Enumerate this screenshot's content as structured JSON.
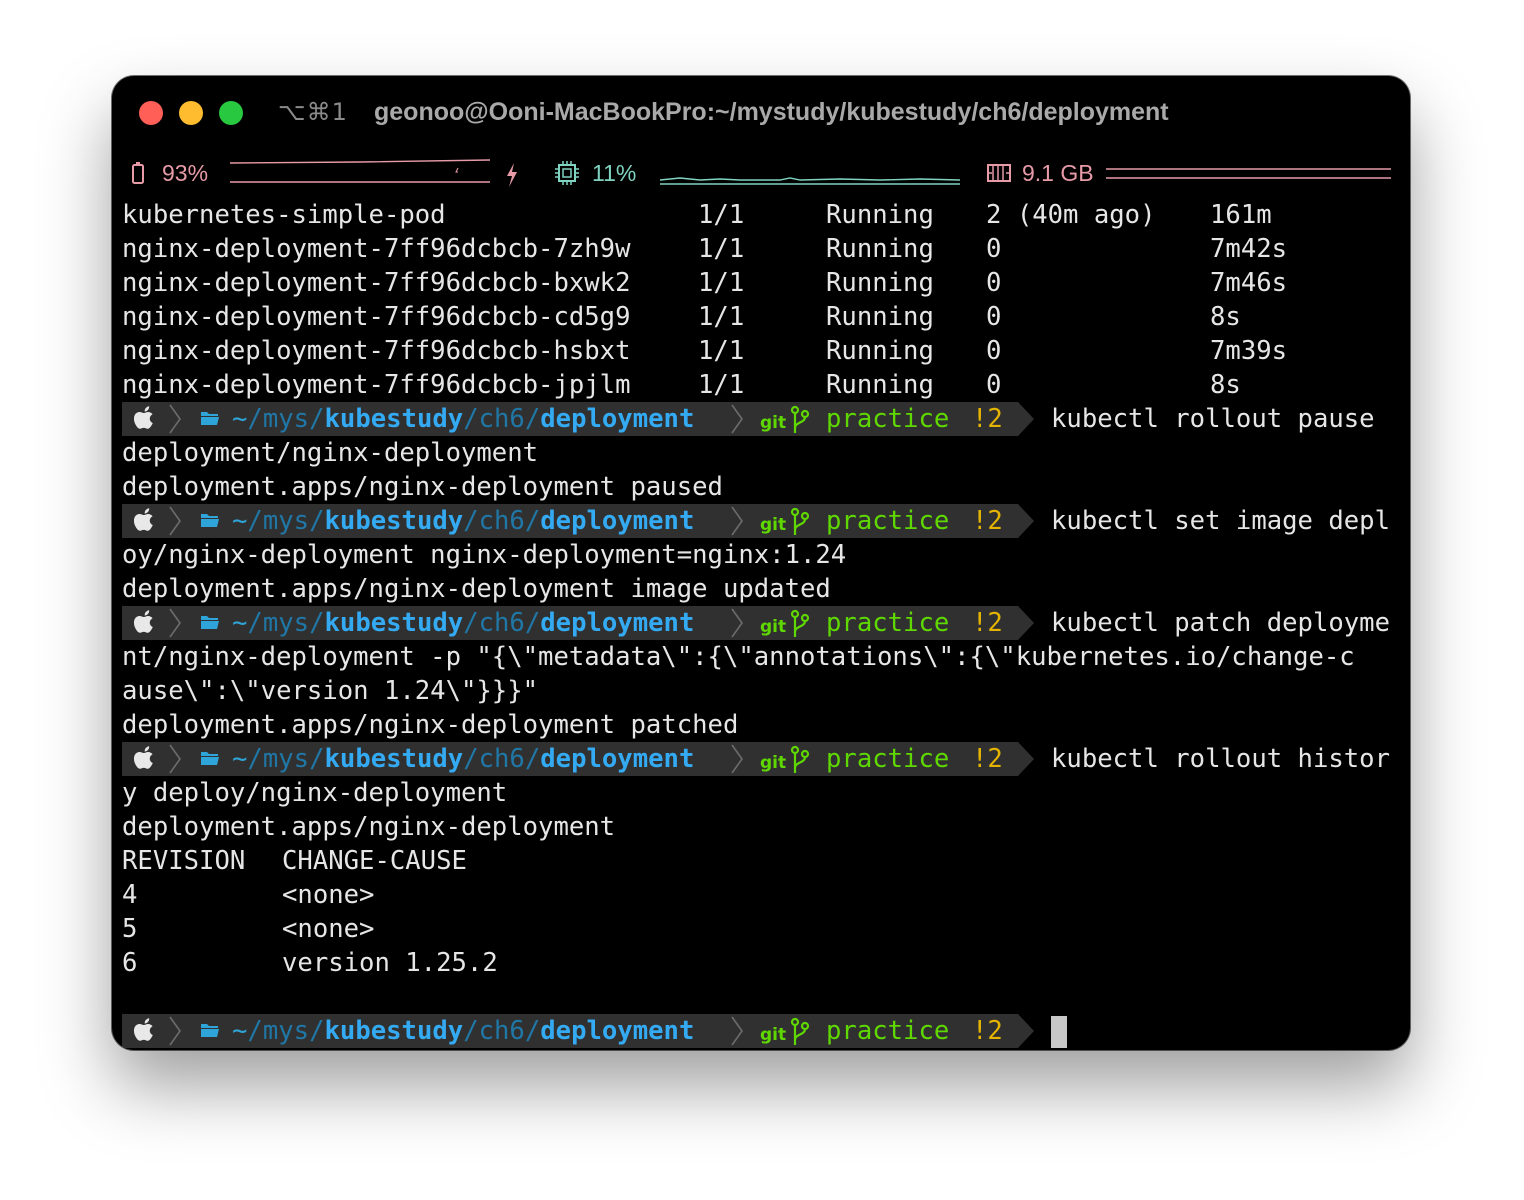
{
  "window": {
    "shortcut": "⌥⌘1",
    "title": "geonoo@Ooni-MacBookPro:~/mystudy/kubestudy/ch6/deployment"
  },
  "statusbar": {
    "battery_percent": "93%",
    "cpu_percent": "11%",
    "memory": "9.1 GB",
    "colors": {
      "battery": "#e79ba7",
      "cpu": "#7fd3c0",
      "memory": "#e79ba7"
    }
  },
  "pods": [
    {
      "name": "kubernetes-simple-pod",
      "ready": "1/1",
      "status": "Running",
      "restarts": "2 (40m ago)",
      "age": "161m"
    },
    {
      "name": "nginx-deployment-7ff96dcbcb-7zh9w",
      "ready": "1/1",
      "status": "Running",
      "restarts": "0",
      "age": "7m42s"
    },
    {
      "name": "nginx-deployment-7ff96dcbcb-bxwk2",
      "ready": "1/1",
      "status": "Running",
      "restarts": "0",
      "age": "7m46s"
    },
    {
      "name": "nginx-deployment-7ff96dcbcb-cd5g9",
      "ready": "1/1",
      "status": "Running",
      "restarts": "0",
      "age": "8s"
    },
    {
      "name": "nginx-deployment-7ff96dcbcb-hsbxt",
      "ready": "1/1",
      "status": "Running",
      "restarts": "0",
      "age": "7m39s"
    },
    {
      "name": "nginx-deployment-7ff96dcbcb-jpjlm",
      "ready": "1/1",
      "status": "Running",
      "restarts": "0",
      "age": "8s"
    }
  ],
  "prompt": {
    "path_tilde": "~",
    "path_parts": [
      "/",
      "mys",
      "/",
      "kubestudy",
      "/",
      "ch6",
      "/",
      "deployment"
    ],
    "git_label": "git",
    "branch": "practice",
    "dirty": "!2",
    "icons": [
      "apple-icon",
      "chevron-right-icon",
      "folder-icon",
      "git-branch-icon"
    ],
    "colors": {
      "segment_bg": "#303030",
      "path": "#33aaf2",
      "branch": "#5fd700",
      "dirty": "#e4b400"
    }
  },
  "commands": [
    {
      "cmd": "kubectl rollout pause",
      "output": [
        "deployment/nginx-deployment",
        "deployment.apps/nginx-deployment paused"
      ]
    },
    {
      "cmd": "kubectl set image depl",
      "output": [
        "oy/nginx-deployment nginx-deployment=nginx:1.24",
        "deployment.apps/nginx-deployment image updated"
      ]
    },
    {
      "cmd": "kubectl patch deployme",
      "output": [
        "nt/nginx-deployment -p \"{\\\"metadata\\\":{\\\"annotations\\\":{\\\"kubernetes.io/change-c",
        "ause\\\":\\\"version 1.24\\\"}}}\"",
        "deployment.apps/nginx-deployment patched"
      ]
    },
    {
      "cmd": "kubectl rollout histor",
      "output": [
        "y deploy/nginx-deployment",
        "deployment.apps/nginx-deployment"
      ]
    }
  ],
  "history": {
    "headers": {
      "revision": "REVISION",
      "cause": "CHANGE-CAUSE"
    },
    "rows": [
      {
        "revision": "4",
        "cause": "<none>"
      },
      {
        "revision": "5",
        "cause": "<none>"
      },
      {
        "revision": "6",
        "cause": "version 1.25.2"
      }
    ]
  }
}
